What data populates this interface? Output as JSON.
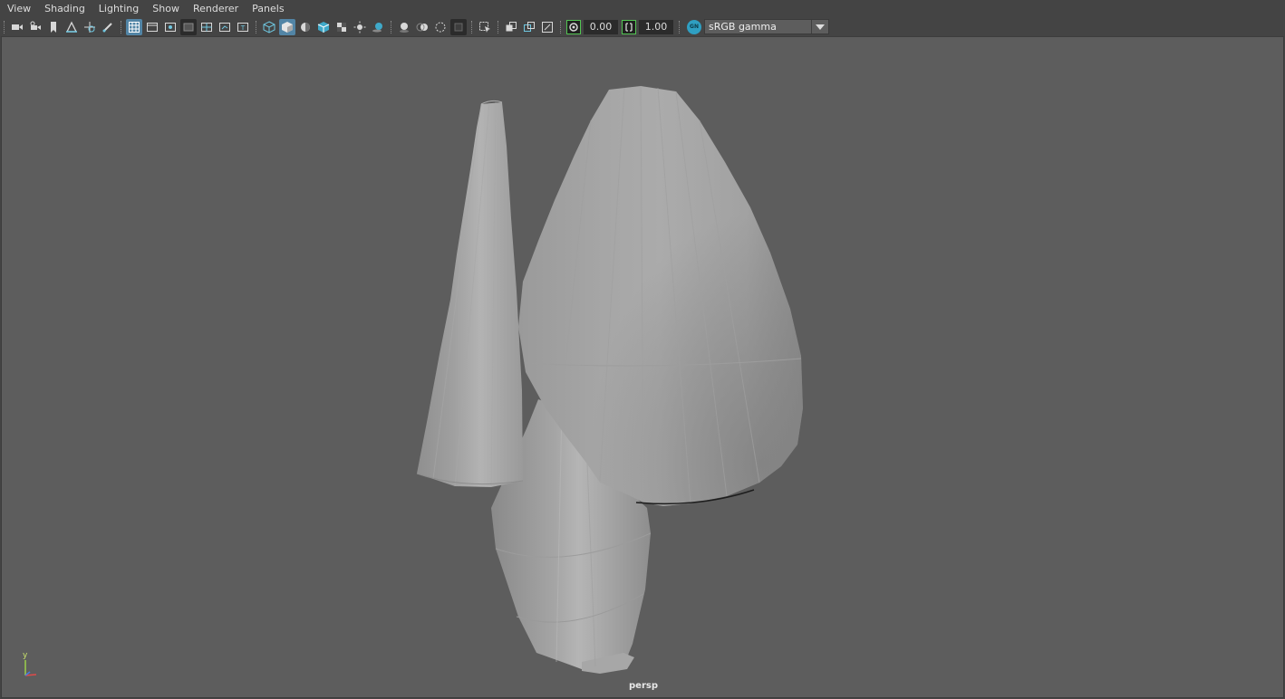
{
  "menu": [
    "View",
    "Shading",
    "Lighting",
    "Show",
    "Renderer",
    "Panels"
  ],
  "toolbar": {
    "exposure_value": "0.00",
    "gamma_value": "1.00",
    "color_space_badge": "GN",
    "color_space": "sRGB gamma"
  },
  "viewport": {
    "camera_label": "persp",
    "axis_y_label": "y",
    "background_color": "#5d5d5d",
    "accent_color": "#5285a6"
  }
}
